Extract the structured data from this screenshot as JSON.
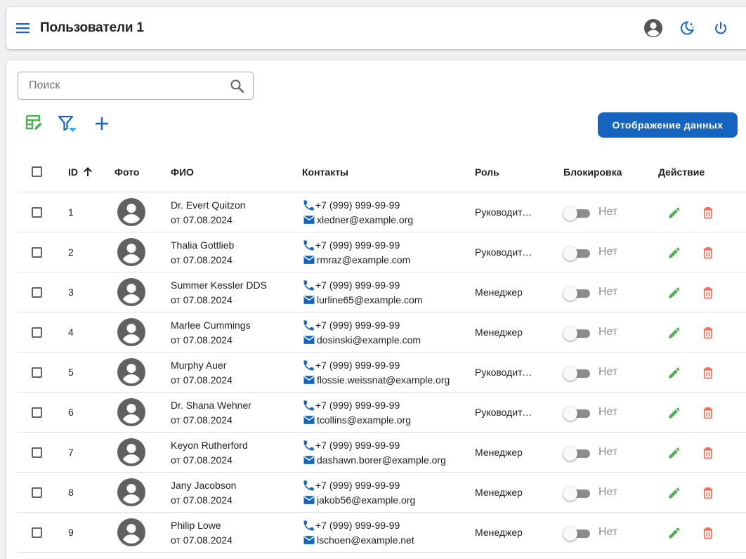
{
  "header": {
    "title": "Пользователи 1",
    "icons": [
      "menu-icon",
      "account-icon",
      "dark-mode-icon",
      "power-icon"
    ]
  },
  "search": {
    "placeholder": "Поиск",
    "value": ""
  },
  "toolbar": {
    "icons": [
      "table-edit-icon",
      "filter-icon",
      "add-icon"
    ],
    "display_button_label": "Отображение данных"
  },
  "colors": {
    "primary": "#1565c0",
    "edit": "#4caf50",
    "delete": "#ef6c57",
    "switch_off": "#8c8c8c"
  },
  "table": {
    "columns": {
      "id": "ID",
      "photo": "Фото",
      "name": "ФИО",
      "contacts": "Контакты",
      "role": "Роль",
      "block": "Блокировка",
      "action": "Действие"
    },
    "sort": {
      "column": "ID",
      "direction": "ascending"
    },
    "rows": [
      {
        "id": "1",
        "name": "Dr. Evert Quitzon",
        "date": "от 07.08.2024",
        "phone": "+7 (999) 999-99-99",
        "email": "xledner@example.org",
        "role": "Руководитель",
        "blocked": "Нет"
      },
      {
        "id": "2",
        "name": "Thalia Gottlieb",
        "date": "от 07.08.2024",
        "phone": "+7 (999) 999-99-99",
        "email": "rmraz@example.com",
        "role": "Руководитель",
        "blocked": "Нет"
      },
      {
        "id": "3",
        "name": "Summer Kessler DDS",
        "date": "от 07.08.2024",
        "phone": "+7 (999) 999-99-99",
        "email": "lurline65@example.com",
        "role": "Менеджер",
        "blocked": "Нет"
      },
      {
        "id": "4",
        "name": "Marlee Cummings",
        "date": "от 07.08.2024",
        "phone": "+7 (999) 999-99-99",
        "email": "dosinski@example.com",
        "role": "Менеджер",
        "blocked": "Нет"
      },
      {
        "id": "5",
        "name": "Murphy Auer",
        "date": "от 07.08.2024",
        "phone": "+7 (999) 999-99-99",
        "email": "flossie.weissnat@example.org",
        "role": "Руководитель",
        "blocked": "Нет"
      },
      {
        "id": "6",
        "name": "Dr. Shana Wehner",
        "date": "от 07.08.2024",
        "phone": "+7 (999) 999-99-99",
        "email": "tcollins@example.org",
        "role": "Руководитель",
        "blocked": "Нет"
      },
      {
        "id": "7",
        "name": "Keyon Rutherford",
        "date": "от 07.08.2024",
        "phone": "+7 (999) 999-99-99",
        "email": "dashawn.borer@example.org",
        "role": "Менеджер",
        "blocked": "Нет"
      },
      {
        "id": "8",
        "name": "Jany Jacobson",
        "date": "от 07.08.2024",
        "phone": "+7 (999) 999-99-99",
        "email": "jakob56@example.org",
        "role": "Менеджер",
        "blocked": "Нет"
      },
      {
        "id": "9",
        "name": "Philip Lowe",
        "date": "от 07.08.2024",
        "phone": "+7 (999) 999-99-99",
        "email": "lschoen@example.net",
        "role": "Менеджер",
        "blocked": "Нет"
      }
    ]
  }
}
